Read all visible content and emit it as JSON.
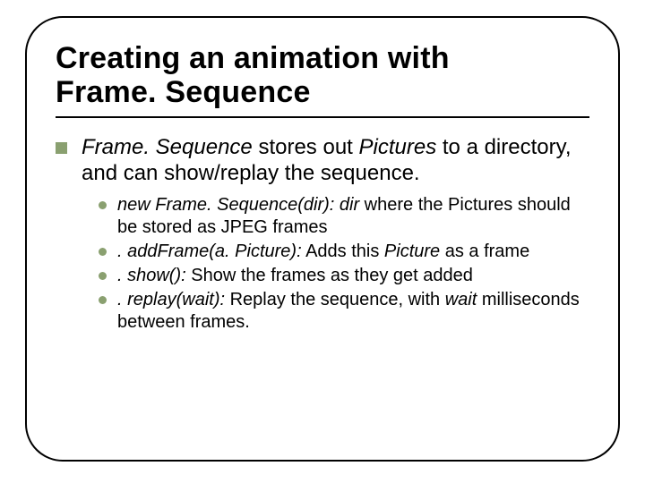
{
  "title_line1": "Creating an animation with",
  "title_line2": "Frame. Sequence",
  "main_bullet": {
    "pre_italic_1": "Frame. Sequence",
    "mid_1": " stores out ",
    "italic_2": "Pictures",
    "post": " to a directory, and can show/replay the sequence."
  },
  "subs": [
    {
      "lead_i": "new Frame. Sequence(dir): dir",
      "rest": " where the Pictures should be stored as JPEG frames"
    },
    {
      "lead_i": ". addFrame(a. Picture):",
      "mid": " Adds this ",
      "inner_i": "Picture",
      "rest": " as a frame"
    },
    {
      "lead_i": ". show():",
      "rest": " Show the frames as they get added"
    },
    {
      "lead_i": ". replay(wait):",
      "mid": " Replay the sequence, with ",
      "inner_i": "wait",
      "rest": " milliseconds between frames."
    }
  ]
}
